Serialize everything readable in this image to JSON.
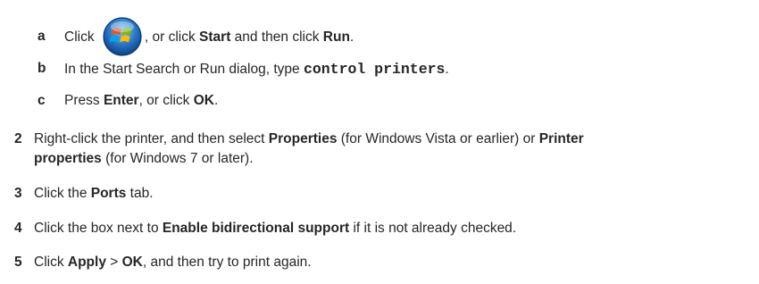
{
  "substeps": [
    {
      "letter": "a",
      "t1": "Click ",
      "t2": ", or click ",
      "b1": "Start",
      "t3": " and then click ",
      "b2": "Run",
      "t4": ".",
      "icon": "windows-start-orb-icon"
    },
    {
      "letter": "b",
      "t1": "In the Start Search or Run dialog, type ",
      "code": "control printers",
      "t2": "."
    },
    {
      "letter": "c",
      "t1": "Press ",
      "b1": "Enter",
      "t2": ", or click ",
      "b2": "OK",
      "t3": "."
    }
  ],
  "steps": [
    {
      "num": "2",
      "line1_t1": "Right-click the printer, and then select ",
      "line1_b1": "Properties",
      "line1_t2": " (for Windows Vista or earlier) or ",
      "line1_b2": "Printer",
      "line2_b1": "properties",
      "line2_t1": " (for Windows 7 or later)."
    },
    {
      "num": "3",
      "t1": "Click the ",
      "b1": "Ports",
      "t2": " tab."
    },
    {
      "num": "4",
      "t1": "Click the box next to ",
      "b1": "Enable bidirectional support",
      "t2": " if it is not already checked."
    },
    {
      "num": "5",
      "t1": "Click ",
      "b1": "Apply",
      "t2": " > ",
      "b2": "OK",
      "t3": ", and then try to print again."
    }
  ]
}
